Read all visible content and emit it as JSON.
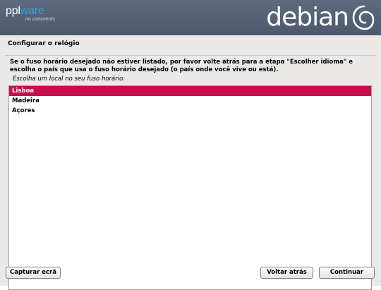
{
  "banner": {
    "ppl_logo_part1": "ppl",
    "ppl_logo_part2": "ware",
    "ppl_logo_tagline": "no comments",
    "brand": "debian"
  },
  "dialog": {
    "title": "Configurar o relógio",
    "description": "Se o fuso horário desejado não estiver listado, por favor volte atrás para a etapa \"Escolher idioma\" e escolha o país que usa o fuso horário desejado (o país onde você vive ou está).",
    "prompt": "Escolha um local no seu fuso horário:",
    "options": [
      {
        "label": "Lisboa",
        "selected": true
      },
      {
        "label": "Madeira",
        "selected": false
      },
      {
        "label": "Açores",
        "selected": false
      }
    ]
  },
  "buttons": {
    "screenshot": "Capturar ecrã",
    "back": "Voltar atrás",
    "continue": "Continuar"
  },
  "colors": {
    "banner": "#56607a",
    "selection": "#c50e4a",
    "background": "#eae9e8"
  }
}
